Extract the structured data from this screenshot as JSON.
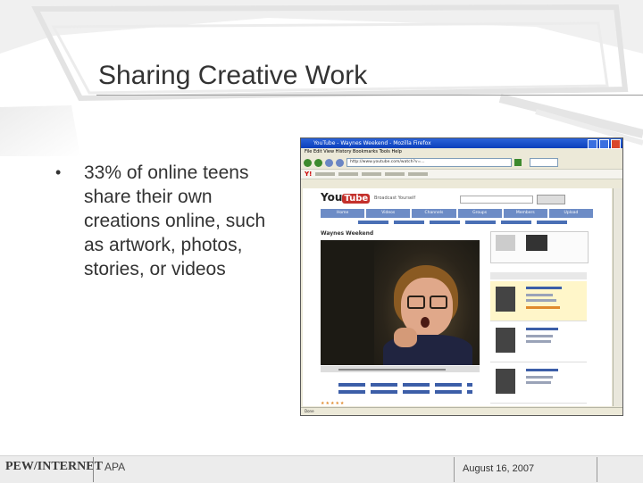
{
  "slide": {
    "title": "Sharing Creative Work",
    "bullet": "33% of online teens share their own creations online, such as artwork, photos, stories, or videos"
  },
  "browser": {
    "window_title": "YouTube - Waynes Weekend - Mozilla Firefox",
    "menu": "File  Edit  View  History  Bookmarks  Tools  Help",
    "address": "http://www.youtube.com/watch?v=...",
    "yahoo": "Y!",
    "youtube_logo_you": "You",
    "youtube_logo_tube": "Tube",
    "broadcast": "Broadcast Yourself",
    "tabs": [
      "Home",
      "Videos",
      "Channels",
      "Groups",
      "Members",
      "Upload"
    ],
    "video_title": "Waynes Weekend",
    "stars": "★★★★★",
    "status": "Done"
  },
  "footer": {
    "logo": "PEW/INTERNET",
    "left_text": "APA",
    "right_text": "August 16, 2007"
  },
  "colors": {
    "title": "#333333",
    "youtube_red": "#c4302b",
    "xp_blue": "#0a3fbb",
    "footer_bg": "#ececec"
  }
}
